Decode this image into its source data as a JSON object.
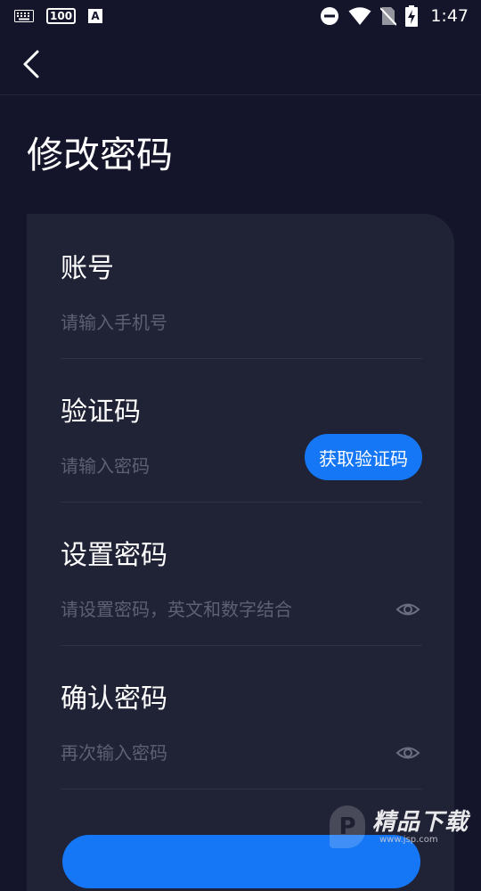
{
  "status_bar": {
    "keyboard_icon": "keyboard-icon",
    "badge_100": "100",
    "badge_a": "A",
    "time": "1:47"
  },
  "header": {
    "title": "修改密码"
  },
  "form": {
    "account": {
      "label": "账号",
      "placeholder": "请输入手机号"
    },
    "code": {
      "label": "验证码",
      "placeholder": "请输入密码",
      "button": "获取验证码"
    },
    "password": {
      "label": "设置密码",
      "placeholder": "请设置密码，英文和数字结合"
    },
    "confirm": {
      "label": "确认密码",
      "placeholder": "再次输入密码"
    }
  },
  "watermark": {
    "title": "精品下载",
    "url": "www.jsp.com",
    "logo_letter": "P"
  },
  "colors": {
    "background": "#14152a",
    "card": "#202235",
    "accent": "#1577f6",
    "placeholder": "#5d6074"
  }
}
